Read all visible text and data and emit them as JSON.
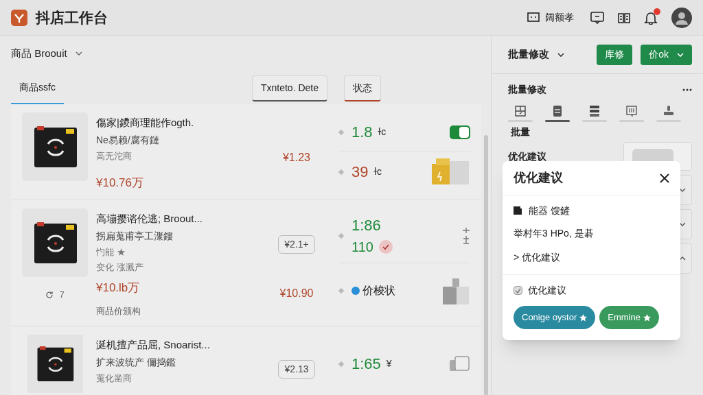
{
  "header": {
    "title": "抖店工作台",
    "link": "阔额孝",
    "notification_badge": true
  },
  "list_header": {
    "selector": "商品 Broouit"
  },
  "tabs": [
    {
      "label": "商品ssfc",
      "selected": true
    }
  ],
  "filters": [
    {
      "label": "Txnteto. Dete"
    },
    {
      "label": "状态"
    }
  ],
  "products": [
    {
      "title": "傷家|鑁商理能作ogth.",
      "lines": [
        "Ne易赖/腐有鏈",
        "高无沱商"
      ],
      "price": "¥10.76万",
      "mid": [
        {
          "kind": "price",
          "text": "¥1.23"
        }
      ],
      "stats": [
        {
          "text": "1.8",
          "unit": "ɫc",
          "color": "#1f8a3a",
          "trail": {
            "kind": "toggle",
            "on": true
          }
        },
        {
          "text": "39",
          "unit": "ɫc",
          "color": "#b0452a",
          "trail": {
            "kind": "folder"
          }
        }
      ]
    },
    {
      "title": "高塴撄谘伦逃; Broout...",
      "lines": [
        "拐扁蒐甫亭工㵵鏤",
        "㣿能 ★",
        "变化 涨溅产"
      ],
      "price": "¥10.lb万",
      "count": "7",
      "footer": "商品价颁构",
      "mid": [
        {
          "kind": "chip",
          "text": "¥2.1+"
        },
        {
          "kind": "price",
          "text": "¥10.90"
        }
      ],
      "stats": [
        {
          "text": "1:86",
          "second": "110",
          "color": "#1f8a3a",
          "trail": {
            "kind": "marks"
          }
        },
        {
          "text": "价梭状",
          "kind": "dotted",
          "color": "#2a8fd6",
          "trail": {
            "kind": "blocks"
          }
        }
      ]
    },
    {
      "title": "涎机擅产品屈, Snoarist...",
      "lines": [
        "扩来波统产 儞捣鑑",
        "蒐化凿商"
      ],
      "mid": [
        {
          "kind": "chip",
          "text": "¥2.13"
        }
      ],
      "stats": [
        {
          "text": "1:65",
          "unit": "¥",
          "color": "#1f8a3a",
          "trail": {
            "kind": "square"
          }
        }
      ]
    }
  ],
  "side": {
    "menu": "批量修改",
    "buttons": [
      {
        "label": "库修",
        "caret": false
      },
      {
        "label": "价ok",
        "caret": true
      }
    ],
    "section": "批量修改",
    "tools": [
      {
        "label": "批量",
        "selected": false
      },
      {
        "selected": true
      },
      {
        "selected": false
      },
      {
        "selected": false
      },
      {
        "selected": false
      }
    ],
    "suggest_label": "优化建议",
    "cards": [
      {
        "expanded": false
      },
      {
        "expanded": false
      },
      {
        "expanded": true
      }
    ]
  },
  "dialog": {
    "title": "优化建议",
    "rows": [
      "能器 馊鏟",
      "举村年3 HPo, 是碁",
      "> 优化建议"
    ],
    "checkbox": {
      "label": "优化建议",
      "checked": true
    },
    "buttons": [
      {
        "label": "Conige oystor",
        "color": "#2a8aa0"
      },
      {
        "label": "Emmine",
        "color": "#3a9a5e"
      }
    ]
  }
}
